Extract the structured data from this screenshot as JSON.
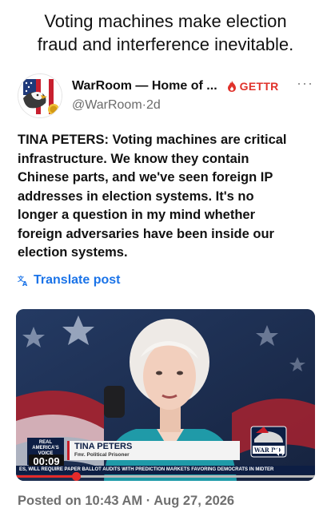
{
  "caption": {
    "line1": "Voting machines make election",
    "line2": "fraud and interference inevitable."
  },
  "post": {
    "display_name": "WarRoom — Home of ...",
    "platform_label": "GETTR",
    "handle": "@WarRoom",
    "separator": " · ",
    "age": "2d",
    "more_label": "···",
    "text_lines": [
      "TINA PETERS: Voting machines are critical",
      "infrastructure. We know they contain",
      "Chinese parts, and we've seen foreign IP",
      "addresses in election systems. It's no",
      "longer a question in my mind whether",
      "foreign adversaries have been inside our",
      "election systems."
    ],
    "translate_label": "Translate post",
    "posted_line": "Posted on 10:43 AM · Aug 27, 2026"
  },
  "video": {
    "logo_text": "REAL\nAMERICA'S\nVOICE",
    "timestamp": "00:09",
    "name": "TINA PETERS",
    "title": "Fmr. Political Prisoner",
    "ticker": "ES, WILL REQUIRE PAPER BALLOT AUDITS       WITH PREDICTION MARKETS FAVORING DEMOCRATS IN MIDTER",
    "wr_logo_text": "WAR RO",
    "progress_fraction": 0.2
  },
  "colors": {
    "accent_blue": "#1a73e8",
    "gettr_red": "#e0322b",
    "progress_red": "#e42a2a",
    "network_navy": "#0d1e44"
  },
  "icons": {
    "avatar": "eagle-flag-avatar",
    "gettr": "flame-icon",
    "translate": "translate-icon",
    "volume": "volume-icon",
    "more": "more-dots-icon"
  }
}
